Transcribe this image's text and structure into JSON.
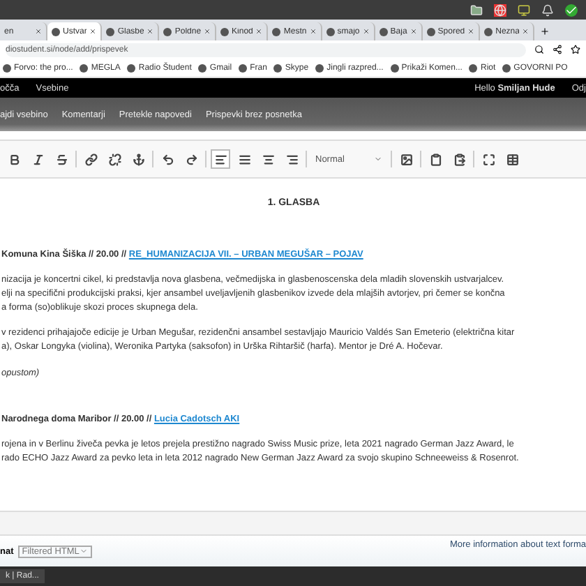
{
  "browser": {
    "tabs": [
      {
        "label": "en",
        "selected": false
      },
      {
        "label": "Ustvar",
        "selected": true
      },
      {
        "label": "Glasbe",
        "selected": false
      },
      {
        "label": "Poldne",
        "selected": false
      },
      {
        "label": "Kinod",
        "selected": false
      },
      {
        "label": "Mestn",
        "selected": false
      },
      {
        "label": "smajo",
        "selected": false
      },
      {
        "label": "Baja",
        "selected": false
      },
      {
        "label": "Spored",
        "selected": false
      },
      {
        "label": "Nezna",
        "selected": false
      }
    ],
    "url": "diostudent.si/node/add/prispevek",
    "bookmarks": [
      "Forvo: the pro...",
      "MEGLA",
      "Radio Študent",
      "Gmail",
      "Fran",
      "Skype",
      "Jingli razpred...",
      "Prikaži Komen...",
      "Riot",
      "GOVORNI PO"
    ]
  },
  "admin_bar": {
    "items": [
      "očča",
      "Vsebine"
    ],
    "greeting": "Hello",
    "user": "Smiljan Hude",
    "logout": "Odj"
  },
  "secondary_nav": [
    "ajdi vsebino",
    "Komentarji",
    "Pretekle napovedi",
    "Prispevki brez posnetka"
  ],
  "toolbar": {
    "alignment": [
      {
        "selected": true
      },
      {
        "selected": false
      },
      {
        "selected": false
      },
      {
        "selected": false
      }
    ],
    "format": "Normal"
  },
  "content": {
    "heading": "1. GLASBA",
    "events": [
      {
        "title": "Komuna Kina Šiška // 20.00 //",
        "link": "RE_HUMANIZACIJA VII. – URBAN MEGUŠAR – POJAV",
        "paragraphs": [
          [
            "nizacija je koncertni cikel, ki predstavlja nova glasbena, večmedijska in glasbenoscenska dela mladih slovenskih ustvarjalcev.",
            "elji na specifični produkcijski praksi, kjer ansambel uveljavljenih glasbenikov izvede dela mlajših avtorjev, pri čemer se končna",
            "a forma (so)oblikuje skozi proces skupnega dela."
          ],
          [
            "v rezidenci prihajajoče edicije je Urban Megušar, rezidenčni ansambel sestavljajo Mauricio Valdés San Emeterio (električna kitar",
            "a), Oskar Longyka (violina), Weronika Partyka (saksofon) in Urška Rihtaršič (harfa). Mentor je Dré A. Hočevar."
          ]
        ],
        "note": "opustom)"
      },
      {
        "title": "Narodnega doma Maribor // 20.00 //",
        "link": "Lucia Cadotsch AKI",
        "paragraphs": [
          [
            "rojena in v Berlinu živeča pevka je letos prejela prestižno nagrado Swiss Music prize, leta 2021 nagrado German Jazz Award, le",
            "rado ECHO Jazz Award za pevko leta in leta 2012 nagrado New German Jazz Award za svojo skupino Schneeweiss & Rosenrot."
          ]
        ]
      }
    ]
  },
  "text_format": {
    "label": "nat",
    "value": "Filtered HTML",
    "help": "More information about text forma"
  },
  "taskbar": {
    "items": [
      "k | Rad..."
    ]
  }
}
